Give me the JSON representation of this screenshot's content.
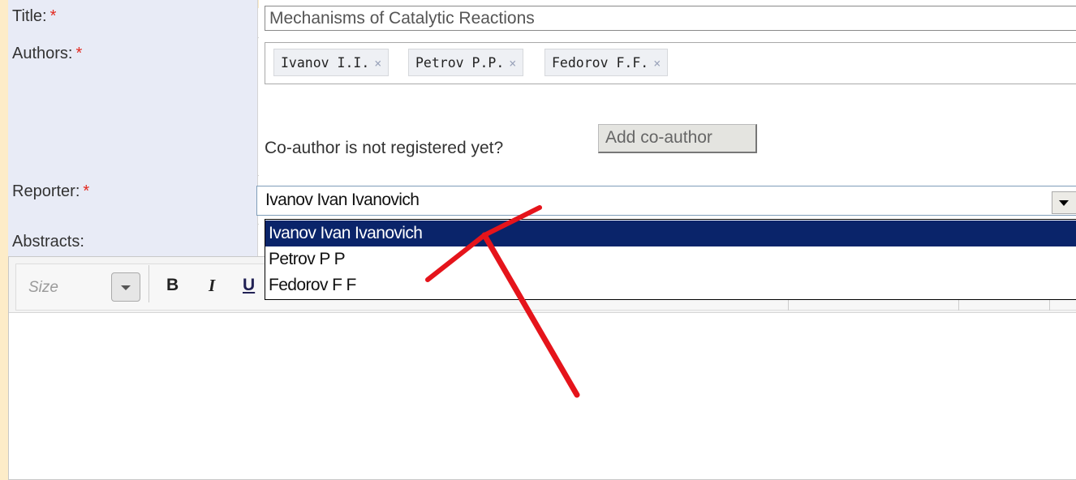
{
  "form": {
    "title": {
      "label": "Title:",
      "required_mark": "*",
      "value": "Mechanisms of Catalytic Reactions"
    },
    "authors": {
      "label": "Authors:",
      "required_mark": "*",
      "tags": [
        {
          "name": "Ivanov I.I.",
          "remove": "×"
        },
        {
          "name": "Petrov P.P.",
          "remove": "×"
        },
        {
          "name": "Fedorov F.F.",
          "remove": "×"
        }
      ],
      "coauthor_prompt": "Co-author is not registered yet?",
      "add_coauthor_button": "Add co-author"
    },
    "reporter": {
      "label": "Reporter:",
      "required_mark": "*",
      "selected": "Ivanov Ivan Ivanovich",
      "options": [
        "Ivanov Ivan Ivanovich",
        "Petrov P P",
        "Fedorov F F"
      ],
      "highlighted_index": 0
    },
    "abstracts": {
      "label": "Abstracts:",
      "toolbar": {
        "size_label": "Size",
        "bold": "B",
        "italic": "I",
        "underline": "U"
      }
    }
  },
  "annotation": {
    "arrow_color": "#e5141b"
  },
  "colors": {
    "label_bg": "#e8ebf6",
    "required": "#e2281e",
    "selection": "#0a246a",
    "frame": "#fdecc8"
  },
  "icons": [
    "remove-tag-icon",
    "dropdown-arrow-icon",
    "size-dropdown-icon"
  ]
}
